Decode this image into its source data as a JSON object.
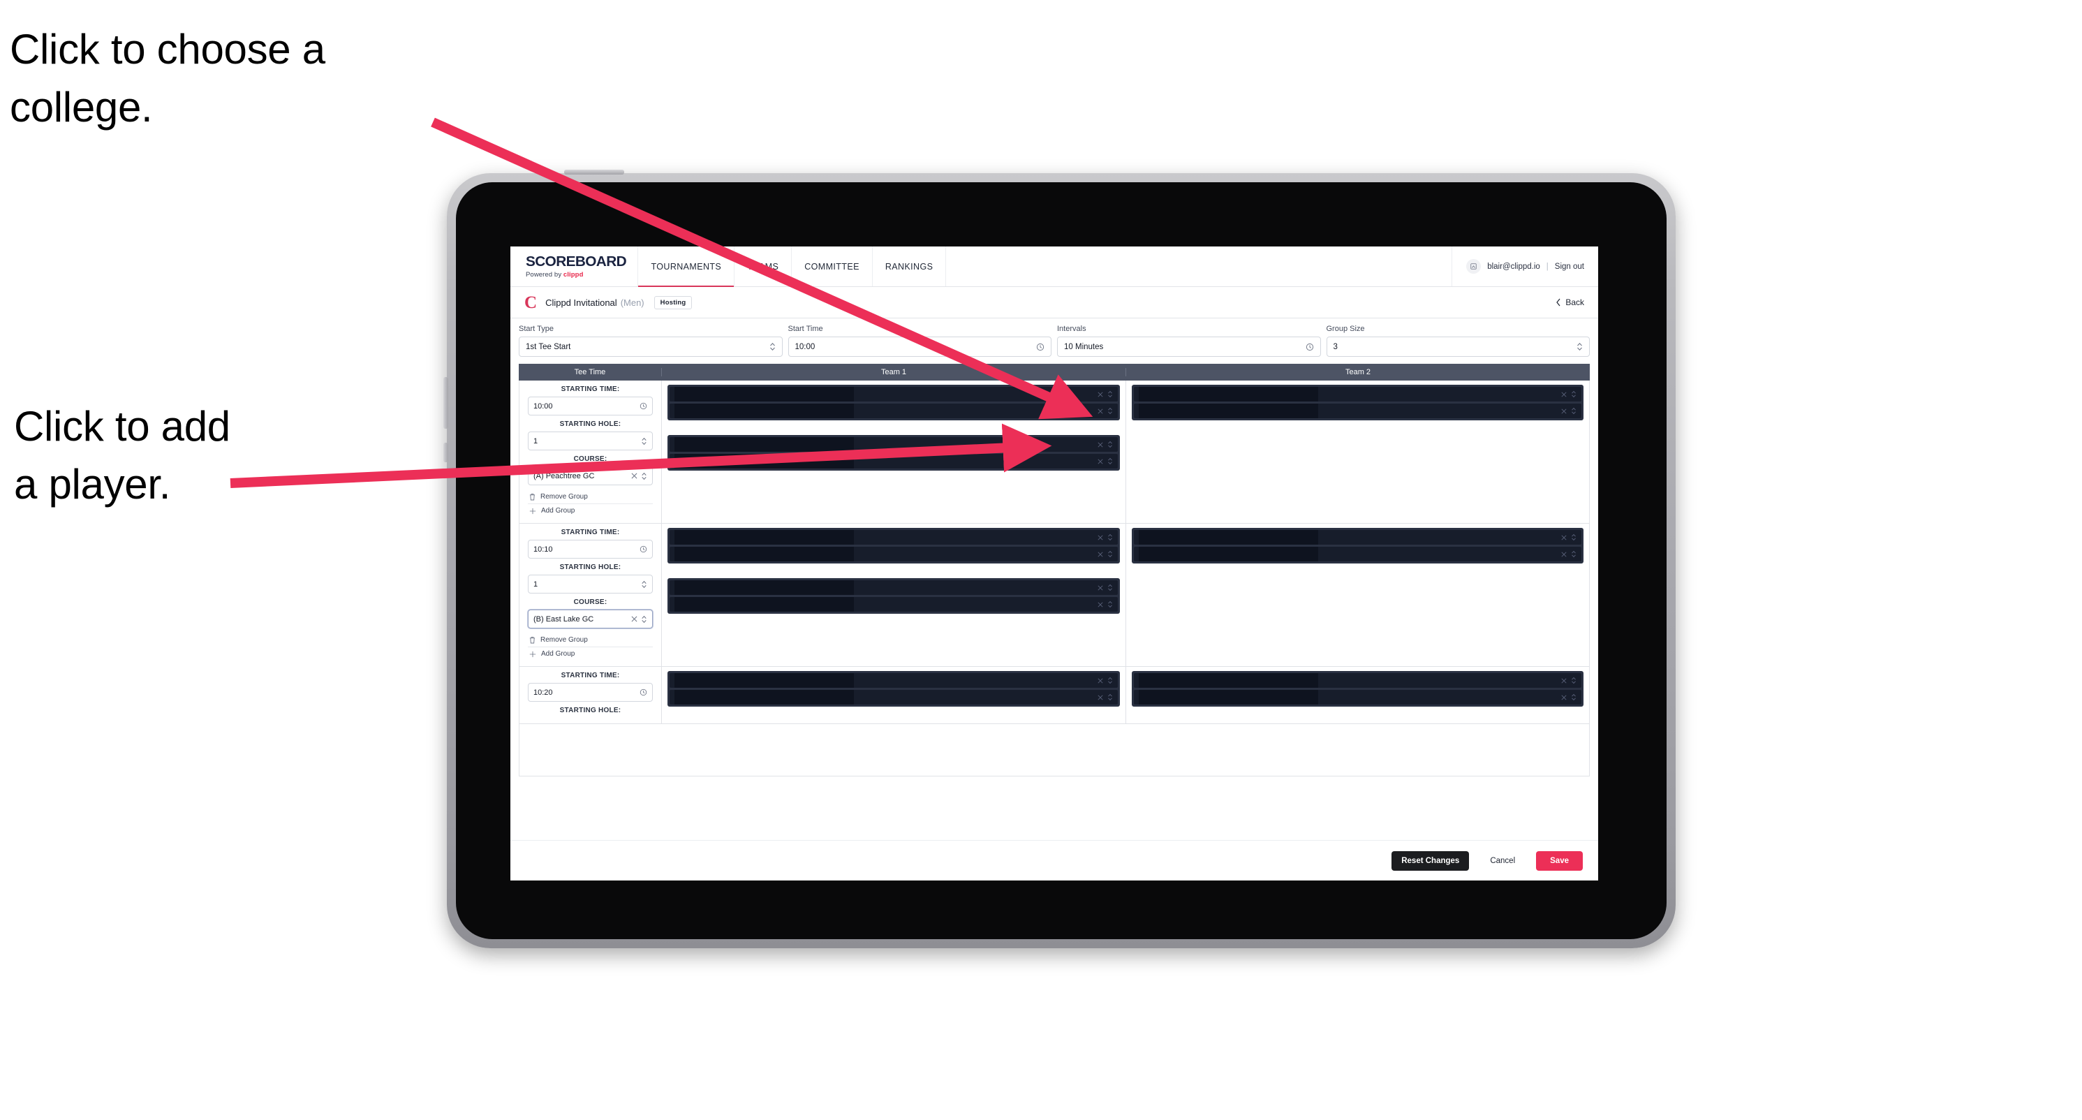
{
  "annotations": [
    {
      "id": "anno-college",
      "text": "Click to choose a\ncollege."
    },
    {
      "id": "anno-player",
      "text": "Click to add\na player."
    }
  ],
  "colors": {
    "accent_pink": "#ec2f57",
    "arrow_pink": "#ec2f57",
    "nav_underline": "#d8365a",
    "table_header_bg": "#4d5465",
    "redacted_block": "#2a3142",
    "redacted_slot": "#171d2b",
    "reset_button_bg": "#1c1d20"
  },
  "topnav": {
    "brand_word": "SCOREBOARD",
    "brand_sub_prefix": "Powered by ",
    "brand_sub_name": "clippd",
    "tabs": [
      {
        "label": "TOURNAMENTS",
        "active": true
      },
      {
        "label": "TEAMS",
        "active": false
      },
      {
        "label": "COMMITTEE",
        "active": false
      },
      {
        "label": "RANKINGS",
        "active": false
      }
    ],
    "avatar_icon": "user-avatar-icon",
    "account_email": "blair@clippd.io",
    "separator": "|",
    "sign_out_label": "Sign out"
  },
  "tournament_bar": {
    "logo_letter": "C",
    "name": "Clippd Invitational",
    "gender": "(Men)",
    "badge": "Hosting",
    "back_label": "Back"
  },
  "form": {
    "fields": [
      {
        "label": "Start Type",
        "value": "1st Tee Start",
        "adorn": "stepper-icon"
      },
      {
        "label": "Start Time",
        "value": "10:00",
        "adorn": "clock-icon"
      },
      {
        "label": "Intervals",
        "value": "10 Minutes",
        "adorn": "clock-icon"
      },
      {
        "label": "Group Size",
        "value": "3",
        "adorn": "stepper-icon"
      }
    ]
  },
  "table": {
    "headers": [
      "Tee Time",
      "Team 1",
      "Team 2"
    ],
    "labels": {
      "starting_time": "STARTING TIME:",
      "starting_hole": "STARTING HOLE:",
      "course": "COURSE:",
      "remove_group": "Remove Group",
      "add_group": "Add Group"
    },
    "groups": [
      {
        "starting_time": "10:00",
        "starting_hole": "1",
        "course": "(A) Peachtree GC",
        "course_focused": false,
        "team1_blocks": [
          2,
          2
        ],
        "team2_blocks": [
          2
        ]
      },
      {
        "starting_time": "10:10",
        "starting_hole": "1",
        "course": "(B) East Lake GC",
        "course_focused": true,
        "team1_blocks": [
          2,
          2
        ],
        "team2_blocks": [
          2
        ]
      },
      {
        "starting_time": "10:20",
        "starting_hole": "",
        "course": "",
        "course_focused": false,
        "team1_blocks": [
          2
        ],
        "team2_blocks": [
          2
        ]
      }
    ]
  },
  "footer": {
    "reset_label": "Reset Changes",
    "cancel_label": "Cancel",
    "save_label": "Save"
  }
}
